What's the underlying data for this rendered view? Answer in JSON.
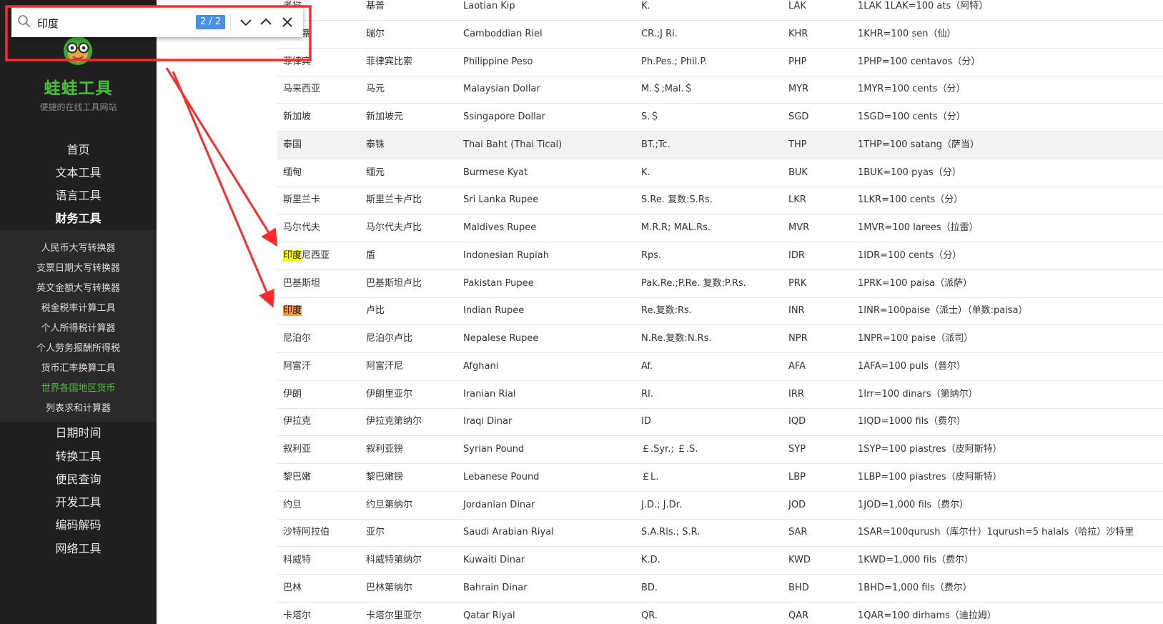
{
  "find_bar": {
    "query": "印度",
    "count": "2 / 2",
    "icons": [
      "search-icon",
      "chevron-down-icon",
      "chevron-up-icon",
      "close-icon"
    ]
  },
  "sidebar": {
    "title": "蛙蛙工具",
    "subtitle": "便捷的在线工具网站",
    "nav_top": [
      "首页",
      "文本工具",
      "语言工具",
      "财务工具"
    ],
    "sub_items": [
      "人民币大写转换器",
      "支票日期大写转换器",
      "英文金额大写转换器",
      "税金税率计算工具",
      "个人所得税计算器",
      "个人劳务报酬所得税",
      "货币汇率换算工具",
      "世界各国地区货币",
      "列表求和计算器"
    ],
    "nav_bottom": [
      "日期时间",
      "转换工具",
      "便民查询",
      "开发工具",
      "编码解码",
      "网络工具"
    ],
    "active_nav": "财务工具",
    "active_sub": "世界各国地区货币"
  },
  "table": {
    "rows": [
      [
        "老挝",
        "基普",
        "Laotian Kip",
        "K.",
        "LAK",
        "1LAK 1LAK=100 ats（阿特）"
      ],
      [
        "柬埔寨",
        "瑞尔",
        "Camboddian Riel",
        "CR.;J Ri.",
        "KHR",
        "1KHR=100 sen（仙）"
      ],
      [
        "菲律宾",
        "菲律宾比索",
        "Philippine Peso",
        "Ph.Pes.; Phil.P.",
        "PHP",
        "1PHP=100 centavos（分）"
      ],
      [
        "马来西亚",
        "马元",
        "Malaysian Dollar",
        "M.＄;Mal.＄",
        "MYR",
        "1MYR=100 cents（分）"
      ],
      [
        "新加坡",
        "新加坡元",
        "Ssingapore Dollar",
        "S.＄",
        "SGD",
        "1SGD=100 cents（分）"
      ],
      [
        "泰国",
        "泰铢",
        "Thai Baht (Thai Tical)",
        "BT.;Tc.",
        "THP",
        "1THP=100 satang（萨当）"
      ],
      [
        "缅甸",
        "缅元",
        "Burmese Kyat",
        "K.",
        "BUK",
        "1BUK=100 pyas（分）"
      ],
      [
        "斯里兰卡",
        "斯里兰卡卢比",
        "Sri Lanka Rupee",
        "S.Re. 复数:S.Rs.",
        "LKR",
        "1LKR=100 cents（分）"
      ],
      [
        "马尔代夫",
        "马尔代夫卢比",
        "Maldives Rupee",
        "M.R.R; MAL.Rs.",
        "MVR",
        "1MVR=100 larees（拉雷）"
      ],
      [
        "印度尼西亚",
        "盾",
        "Indonesian Rupiah",
        "Rps.",
        "IDR",
        "1IDR=100 cents（分）"
      ],
      [
        "巴基斯坦",
        "巴基斯坦卢比",
        "Pakistan Pupee",
        "Pak.Re.;P.Re. 复数:P.Rs.",
        "PRK",
        "1PRK=100 paisa（派萨）"
      ],
      [
        "印度",
        "卢比",
        "Indian Rupee",
        "Re.复数:Rs.",
        "INR",
        "1INR=100paise（派士）（单数:paisa）"
      ],
      [
        "尼泊尔",
        "尼泊尔卢比",
        "Nepalese Rupee",
        "N.Re.复数:N.Rs.",
        "NPR",
        "1NPR=100 paise（派司）"
      ],
      [
        "阿富汗",
        "阿富汗尼",
        "Afghani",
        "Af.",
        "AFA",
        "1AFA=100 puls（普尔）"
      ],
      [
        "伊朗",
        "伊朗里亚尔",
        "Iranian Rial",
        "RI.",
        "IRR",
        "1Irr=100 dinars（第纳尔）"
      ],
      [
        "伊拉克",
        "伊拉克第纳尔",
        "Iraqi Dinar",
        "ID",
        "IQD",
        "1IQD=1000 fils（费尔）"
      ],
      [
        "叙利亚",
        "叙利亚镑",
        "Syrian Pound",
        "￡.Syr.; ￡.S.",
        "SYP",
        "1SYP=100 piastres（皮阿斯特）"
      ],
      [
        "黎巴嫩",
        "黎巴嫩镑",
        "Lebanese Pound",
        "￡L.",
        "LBP",
        "1LBP=100 piastres（皮阿斯特）"
      ],
      [
        "约旦",
        "约旦第纳尔",
        "Jordanian Dinar",
        "J.D.; J.Dr.",
        "JOD",
        "1JOD=1,000 fils（费尔）"
      ],
      [
        "沙特阿拉伯",
        "亚尔",
        "Saudi Arabian Riyal",
        "S.A.Rls.; S.R.",
        "SAR",
        "1SAR=100qurush（库尔什）1qurush=5 halals（哈拉）沙特里"
      ],
      [
        "科威特",
        "科威特第纳尔",
        "Kuwaiti Dinar",
        "K.D.",
        "KWD",
        "1KWD=1,000 fils（费尔）"
      ],
      [
        "巴林",
        "巴林第纳尔",
        "Bahrain Dinar",
        "BD.",
        "BHD",
        "1BHD=1,000 fils（费尔）"
      ],
      [
        "卡塔尔",
        "卡塔尔里亚尔",
        "Qatar Riyal",
        "QR.",
        "QAR",
        "1QAR=100 dirhams（迪拉姆）"
      ]
    ]
  },
  "colors": {
    "sidebar_bg": "#1f1f1f",
    "brand_green": "#4cbf3a",
    "match_highlight": "#ffff00",
    "current_match": "#ff9632",
    "annotation_red": "#ff2a2a",
    "count_badge": "#4a90e2"
  }
}
